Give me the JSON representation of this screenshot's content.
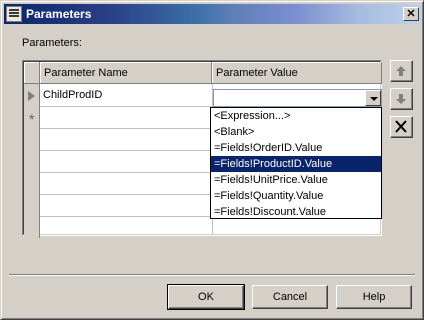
{
  "window": {
    "title": "Parameters",
    "close_glyph": "✕"
  },
  "parameters_label": "Parameters:",
  "grid": {
    "columns": [
      "Parameter Name",
      "Parameter Value"
    ],
    "rows": [
      {
        "name": "ChildProdID",
        "value": ""
      }
    ],
    "new_row_marker": "*"
  },
  "dropdown": {
    "options": [
      "<Expression...>",
      "<Blank>",
      "=Fields!OrderID.Value",
      "=Fields!ProductID.Value",
      "=Fields!UnitPrice.Value",
      "=Fields!Quantity.Value",
      "=Fields!Discount.Value"
    ],
    "selected_index": 3
  },
  "side_buttons": {
    "up": "up-arrow-icon",
    "down": "down-arrow-icon",
    "delete": "delete-x-icon"
  },
  "buttons": {
    "ok": "OK",
    "cancel": "Cancel",
    "help": "Help"
  },
  "colors": {
    "selection": "#0a246a",
    "title_start": "#0a246a"
  }
}
